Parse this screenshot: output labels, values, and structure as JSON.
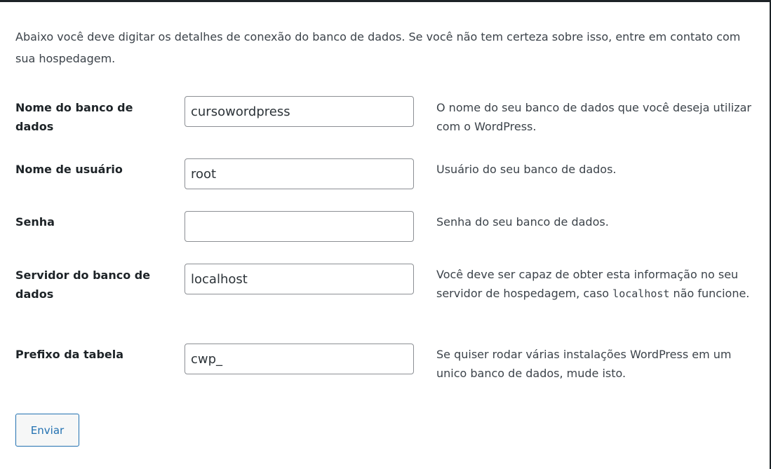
{
  "intro": "Abaixo você deve digitar os detalhes de conexão do banco de dados. Se você não tem certeza sobre isso, entre em contato com sua hospedagem.",
  "fields": [
    {
      "label": "Nome do banco de dados",
      "value": "cursowordpress",
      "desc": "O nome do seu banco de dados que você deseja utilizar com o WordPress."
    },
    {
      "label": "Nome de usuário",
      "value": "root",
      "desc": "Usuário do seu banco de dados."
    },
    {
      "label": "Senha",
      "value": "",
      "desc": "Senha do seu banco de dados."
    },
    {
      "label": "Servidor do banco de dados",
      "value": "localhost",
      "desc_before": "Você deve ser capaz de obter esta informação no seu servidor de hospedagem, caso",
      "desc_code": "localhost",
      "desc_after": "não funcione."
    },
    {
      "label": "Prefixo da tabela",
      "value": "cwp_",
      "desc": "Se quiser rodar várias instalações WordPress em um unico banco de dados, mude isto."
    }
  ],
  "submit_label": "Enviar"
}
